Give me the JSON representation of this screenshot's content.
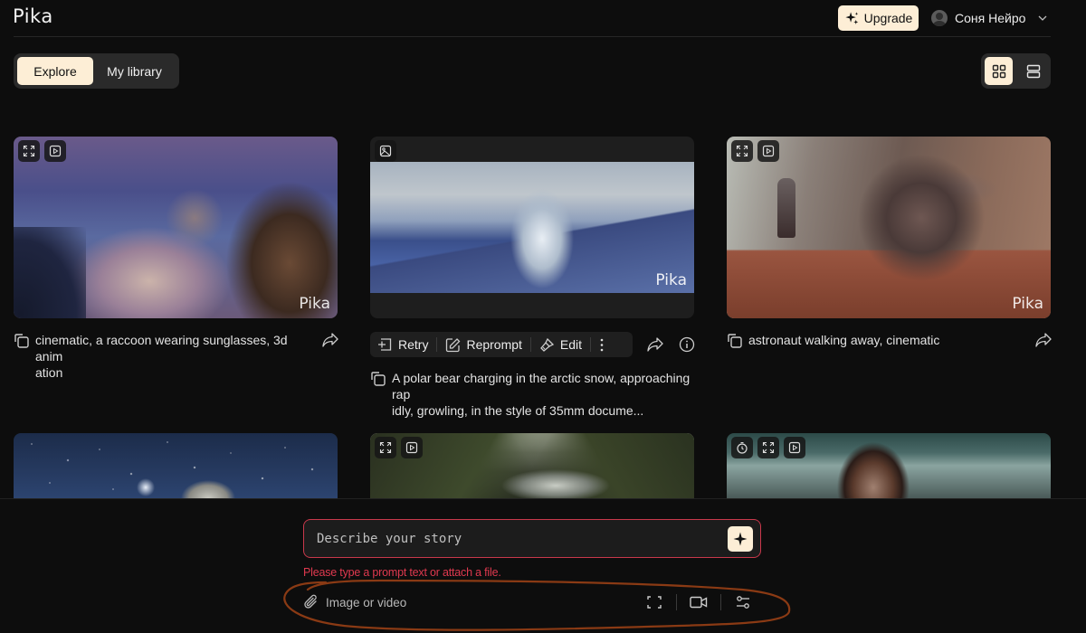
{
  "header": {
    "logo": "Pika",
    "upgrade_label": "Upgrade",
    "user_name": "Соня Нейро"
  },
  "tabs": [
    {
      "label": "Explore",
      "active": true
    },
    {
      "label": "My library",
      "active": false
    }
  ],
  "view_toggle": {
    "active": "grid",
    "options": [
      "grid-view",
      "list-view"
    ]
  },
  "cards": [
    {
      "watermark": "Pika",
      "overlay_icons": [
        "expand-icon",
        "play-icon"
      ],
      "caption": "cinematic, a raccoon wearing sunglasses, 3d animation",
      "caption_line1": "cinematic, a raccoon wearing sunglasses, 3d anim",
      "caption_line2": "ation"
    },
    {
      "watermark": "Pika",
      "overlay_icons": [
        "image-icon"
      ],
      "actions": {
        "retry": "Retry",
        "reprompt": "Reprompt",
        "edit": "Edit"
      },
      "caption_line1": "A polar bear charging in the arctic snow, approaching rap",
      "caption_line2": "idly, growling, in the style of 35mm docume..."
    },
    {
      "watermark": "Pika",
      "overlay_icons": [
        "expand-icon",
        "play-icon"
      ],
      "caption_line1": "astronaut walking away, cinematic"
    },
    {
      "overlay_icons": []
    },
    {
      "overlay_icons": [
        "expand-icon",
        "play-icon"
      ]
    },
    {
      "overlay_icons": [
        "timer-icon",
        "expand-icon",
        "play-icon"
      ]
    }
  ],
  "prompt": {
    "placeholder": "Describe your story",
    "value": "",
    "error": "Please type a prompt text or attach a file.",
    "attach_label": "Image or video"
  },
  "colors": {
    "background": "#0d0d0d",
    "accent": "#fdeed6",
    "error": "#e0394f",
    "annotation": "#8a3a14"
  }
}
